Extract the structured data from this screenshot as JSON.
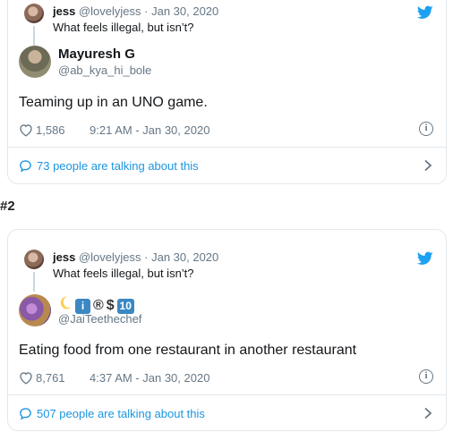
{
  "tweets": [
    {
      "reply_to": {
        "name": "jess",
        "handle": "@lovelyjess",
        "sep": "·",
        "date": "Jan 30, 2020",
        "text": "What feels illegal, but isn’t?"
      },
      "author": {
        "name": "Mayuresh G",
        "handle": "@ab_kya_hi_bole"
      },
      "text": "Teaming up in an UNO game.",
      "likes": "1,586",
      "timestamp": "9:21 AM - Jan 30, 2020",
      "talking": "73 people are talking about this"
    },
    {
      "reply_to": {
        "name": "jess",
        "handle": "@lovelyjess",
        "sep": "·",
        "date": "Jan 30, 2020",
        "text": "What feels illegal, but isn’t?"
      },
      "author": {
        "name_emoji": [
          "crescent-moon",
          "info-square",
          "registered",
          "dollar",
          "ten-square"
        ],
        "handle": "@JaiTeethechef"
      },
      "text": "Eating food from one restaurant in another restaurant",
      "likes": "8,761",
      "timestamp": "4:37 AM - Jan 30, 2020",
      "talking": "507 people are talking about this"
    }
  ],
  "section_label": "#2",
  "colors": {
    "accent": "#1b95e0",
    "muted": "#657786",
    "border": "#e1e8ed",
    "text": "#14171a"
  }
}
